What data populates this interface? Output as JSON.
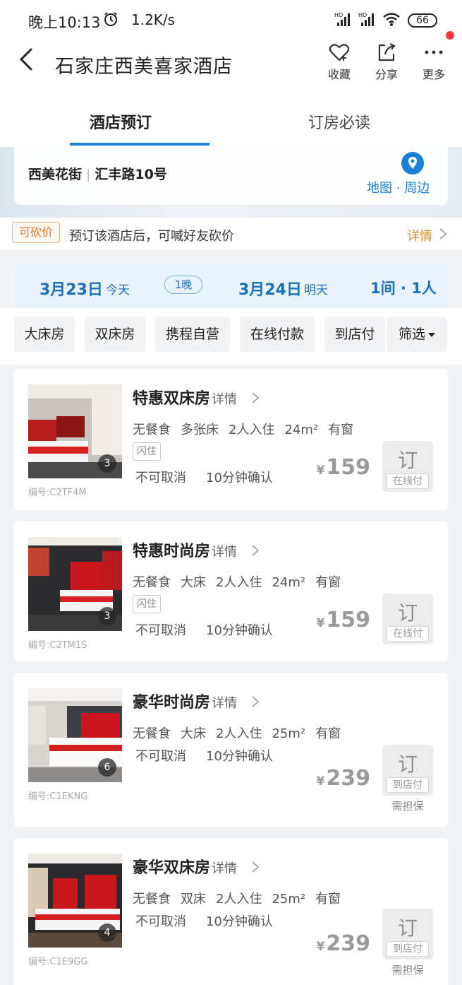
{
  "status": {
    "time": "晚上10:13",
    "speed": "1.2K/s",
    "battery": "66",
    "icons": [
      "alarm-icon",
      "signal-hd-icon",
      "signal-hd-icon",
      "wifi-icon",
      "battery-icon"
    ]
  },
  "header": {
    "title": "石家庄西美喜家酒店",
    "actions": [
      {
        "label": "收藏",
        "icon": "heart-icon"
      },
      {
        "label": "分享",
        "icon": "share-icon"
      },
      {
        "label": "更多",
        "icon": "more-icon"
      }
    ]
  },
  "tabs": [
    {
      "label": "酒店预订",
      "active": true
    },
    {
      "label": "订房必读",
      "active": false
    }
  ],
  "address": {
    "street": "西美花街",
    "road": "汇丰路10号",
    "map_link": "地图 · 周边"
  },
  "bargain": {
    "tag": "可砍价",
    "text": "预订该酒店后，可喊好友砍价",
    "detail": "详情"
  },
  "dates": {
    "checkin": "3月23日",
    "checkin_sub": "今天",
    "nights": "1晚",
    "checkout": "3月24日",
    "checkout_sub": "明天",
    "guests": "1间 · 1人"
  },
  "filters": [
    "大床房",
    "双床房",
    "携程自营",
    "在线付款",
    "到店付",
    "筛选"
  ],
  "rooms": [
    {
      "name": "特惠双床房",
      "detail": "详情",
      "features": [
        "无餐食",
        "多张床",
        "2人入住",
        "24m²",
        "有窗"
      ],
      "flash": "闪住",
      "cancel": "不可取消",
      "confirm": "10分钟确认",
      "currency": "¥",
      "price": "159",
      "book": "订",
      "pay": "在线付",
      "photos": "3",
      "code": "编号:C2TF4M"
    },
    {
      "name": "特惠时尚房",
      "detail": "详情",
      "features": [
        "无餐食",
        "大床",
        "2人入住",
        "24m²",
        "有窗"
      ],
      "flash": "闪住",
      "cancel": "不可取消",
      "confirm": "10分钟确认",
      "currency": "¥",
      "price": "159",
      "book": "订",
      "pay": "在线付",
      "photos": "3",
      "code": "编号:C2TM1S"
    },
    {
      "name": "豪华时尚房",
      "detail": "详情",
      "features": [
        "无餐食",
        "大床",
        "2人入住",
        "25m²",
        "有窗"
      ],
      "cancel": "不可取消",
      "confirm": "10分钟确认",
      "currency": "¥",
      "price": "239",
      "book": "订",
      "pay": "到店付",
      "guarantee": "需担保",
      "photos": "6",
      "code": "编号:C1EKNG"
    },
    {
      "name": "豪华双床房",
      "detail": "详情",
      "features": [
        "无餐食",
        "双床",
        "2人入住",
        "25m²",
        "有窗"
      ],
      "cancel": "不可取消",
      "confirm": "10分钟确认",
      "currency": "¥",
      "price": "239",
      "book": "订",
      "pay": "到店付",
      "guarantee": "需担保",
      "photos": "4",
      "code": "编号:C1E9GG"
    }
  ],
  "colors": {
    "accent": "#1b80dc",
    "bargain": "#e67a2e",
    "notification": "#f23a3a"
  }
}
